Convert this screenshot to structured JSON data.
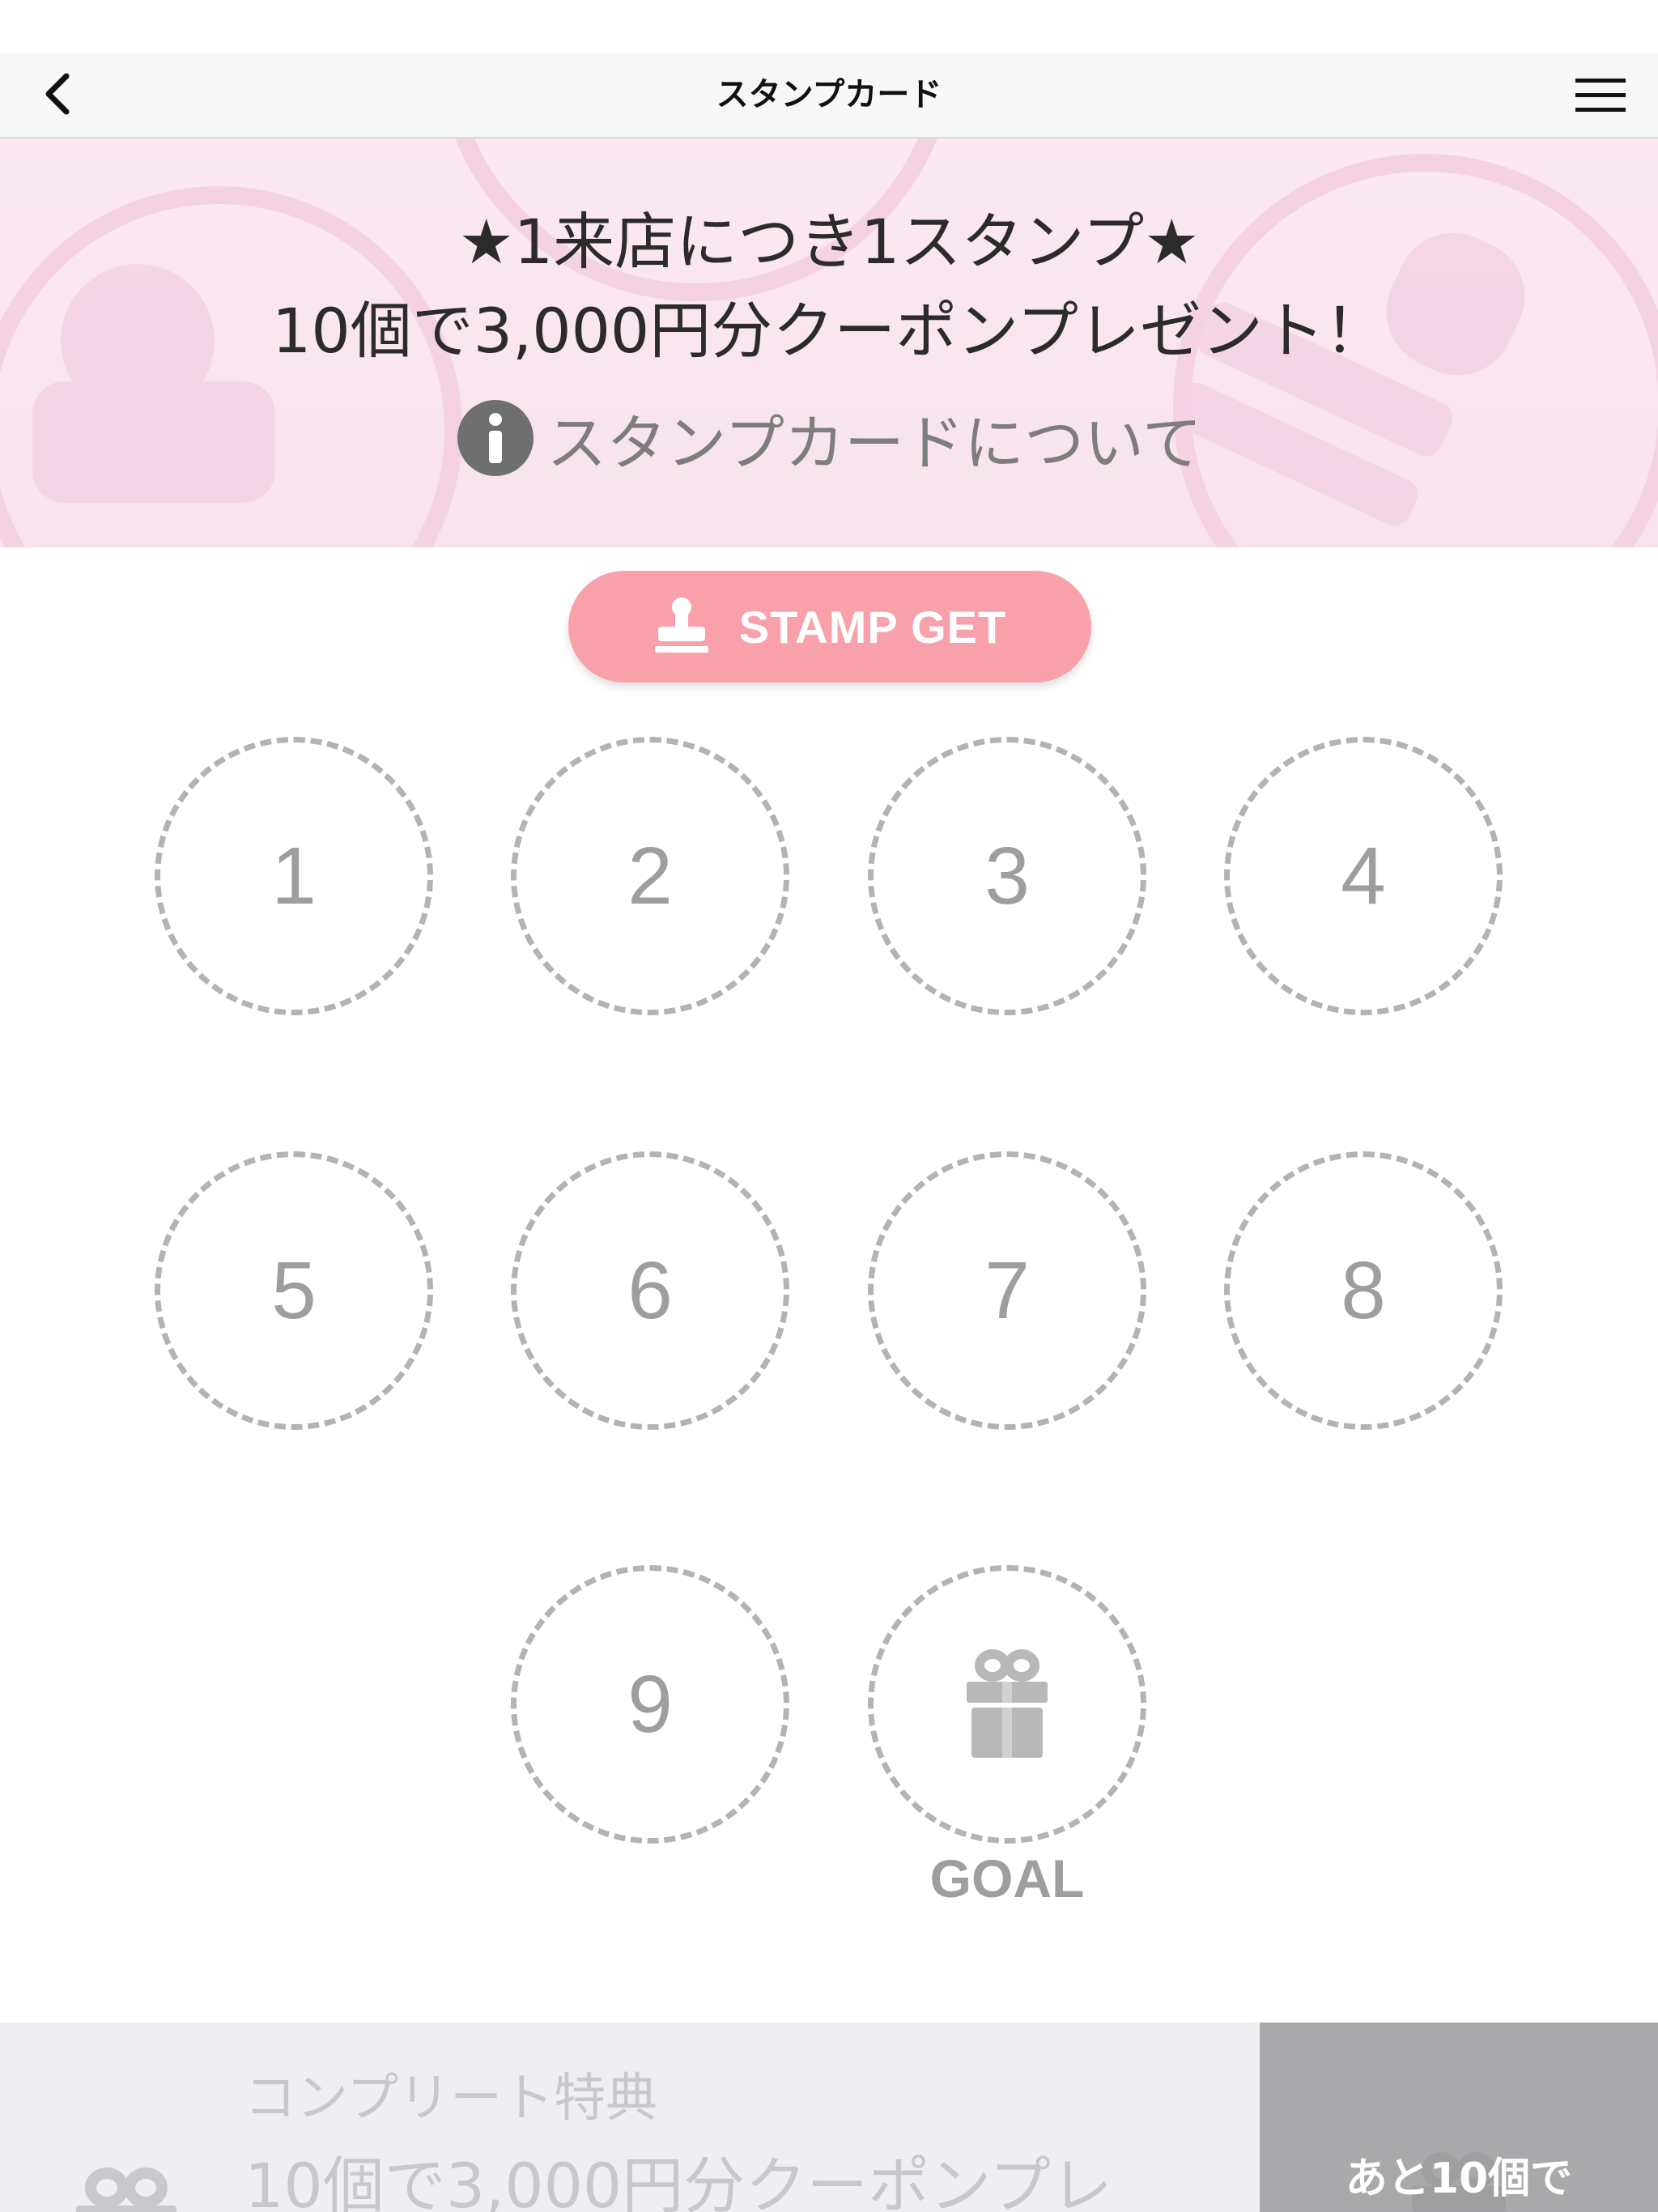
{
  "nav": {
    "title": "スタンプカード",
    "back_icon": "chevron-left-icon",
    "menu_icon": "hamburger-menu-icon"
  },
  "banner": {
    "line1": "★1来店につき1スタンプ★",
    "line2": "10個で3,000円分クーポンプレゼント！",
    "info_icon": "info-icon",
    "info_link": "スタンプカードについて"
  },
  "stamp_button": {
    "icon": "stamp-icon",
    "label": "STAMP GET"
  },
  "stamps": {
    "slots": [
      "1",
      "2",
      "3",
      "4",
      "5",
      "6",
      "7",
      "8",
      "9"
    ],
    "goal_icon": "gift-icon",
    "goal_label": "GOAL",
    "collected": 0,
    "total": 10
  },
  "footer": {
    "gift_icon": "gift-icon",
    "title": "コンプリート特典",
    "description": "10個で3,000円分クーポンプレ",
    "remaining": "あと10個で"
  },
  "colors": {
    "accent_pink": "#f8a1ab",
    "banner_bg": "#fbe6f0",
    "slot_dash": "#b3b3b3",
    "footer_bg": "#efeff3",
    "footer_badge": "#a9a9ab"
  }
}
